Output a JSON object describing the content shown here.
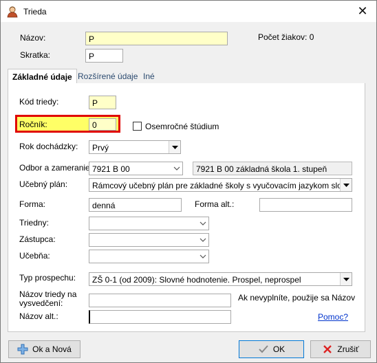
{
  "window": {
    "title": "Trieda",
    "close_glyph": "✕"
  },
  "header": {
    "nazov_label": "Názov:",
    "nazov_value": "P",
    "skratka_label": "Skratka:",
    "skratka_value": "P",
    "pocet_ziakov": "Počet žiakov: 0"
  },
  "tabs": [
    {
      "label": "Základné údaje",
      "active": true
    },
    {
      "label": "Rozšírené údaje",
      "active": false
    },
    {
      "label": "Iné",
      "active": false
    }
  ],
  "form": {
    "kod_triedy_label": "Kód triedy:",
    "kod_triedy_value": "P",
    "rocnik_label": "Ročník:",
    "rocnik_value": "0",
    "osemrocne_label": "Osemročné štúdium",
    "osemrocne_checked": false,
    "rok_dochadzky_label": "Rok dochádzky:",
    "rok_dochadzky_value": "Prvý",
    "odbor_label": "Odbor a zameranie:",
    "odbor_value": "7921 B 00",
    "odbor_description": "7921 B 00 základná škola 1. stupeň",
    "ucebny_plan_label": "Učebný plán:",
    "ucebny_plan_value": "Rámcový učebný plán pre základné školy s vyučovacím jazykom slovenským",
    "forma_label": "Forma:",
    "forma_value": "denná",
    "forma_alt_label": "Forma alt.:",
    "forma_alt_value": "",
    "triedny_label": "Triedny:",
    "triedny_value": "",
    "zastupca_label": "Zástupca:",
    "zastupca_value": "",
    "ucebna_label": "Učebňa:",
    "ucebna_value": "",
    "typ_prospechu_label": "Typ prospechu:",
    "typ_prospechu_value": "ZŠ 0-1 (od 2009): Slovné hodnotenie. Prospel, neprospel",
    "nazov_vysvedcenie_label_1": "Názov triedy na",
    "nazov_vysvedcenie_label_2": "vysvedčení:",
    "nazov_vysvedcenie_value": "",
    "nazov_vysvedcenie_hint": "Ak nevyplníte, použije sa Názov",
    "nazov_alt_label": "Názov alt.:",
    "nazov_alt_value": "",
    "help_link": "Pomoc?"
  },
  "buttons": {
    "ok_a_nova": "Ok a Nová",
    "ok": "OK",
    "zrusit": "Zrušiť"
  },
  "colors": {
    "highlight_fill": "#ffff66",
    "highlight_border": "#e00000",
    "input_yellow": "#ffffc8",
    "link": "#0033cc"
  },
  "icons": {
    "app": "user-icon",
    "add": "plus-icon",
    "ok": "check-icon",
    "cancel": "x-icon"
  }
}
